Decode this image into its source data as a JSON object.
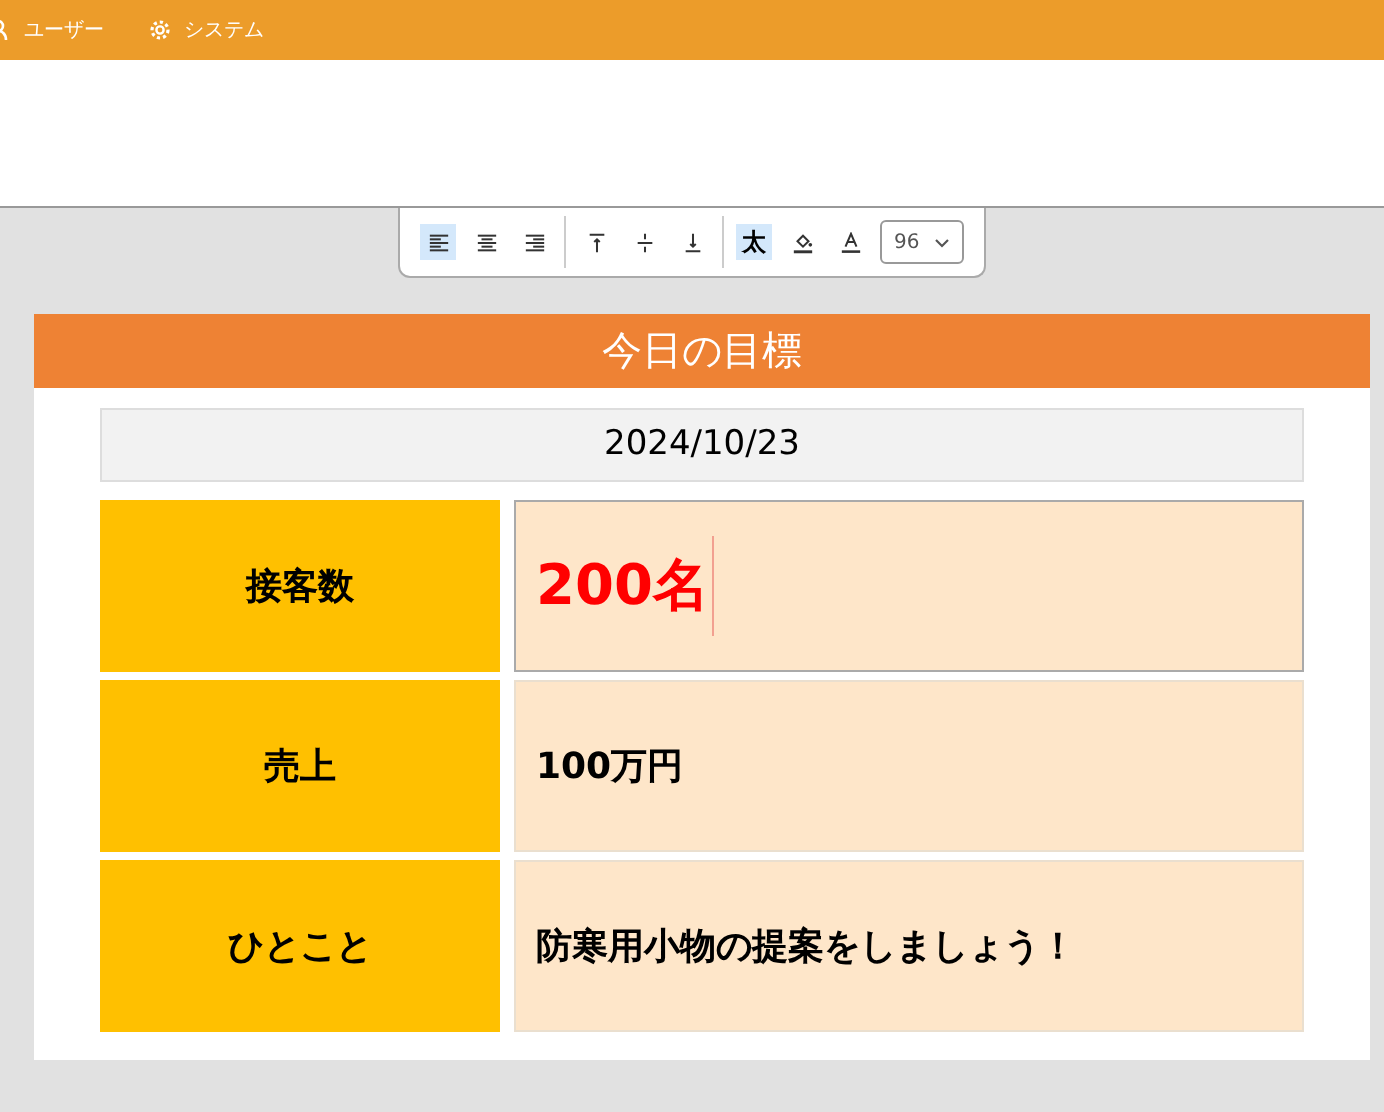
{
  "menu": [
    {
      "kind": "user",
      "label": "ユーザー"
    },
    {
      "kind": "gear",
      "label": "システム"
    }
  ],
  "toolbar": {
    "align": [
      {
        "kind": "left",
        "selected": true
      },
      {
        "kind": "center",
        "selected": false
      },
      {
        "kind": "right",
        "selected": false
      }
    ],
    "valign": [
      {
        "kind": "top",
        "selected": false
      },
      {
        "kind": "middle",
        "selected": false
      },
      {
        "kind": "bottom",
        "selected": false
      }
    ],
    "bold": {
      "label": "太",
      "selected": true
    },
    "font_size": "96"
  },
  "card": {
    "title": "今日の目標",
    "date": "2024/10/23",
    "rows": [
      {
        "label": "接客数",
        "value": "200名",
        "emphasis": true,
        "focused": true
      },
      {
        "label": "売上",
        "value": "100万円",
        "emphasis": false,
        "focused": false
      },
      {
        "label": "ひとこと",
        "value": "防寒用小物の提案をしましょう！",
        "emphasis": false,
        "focused": false
      }
    ]
  }
}
